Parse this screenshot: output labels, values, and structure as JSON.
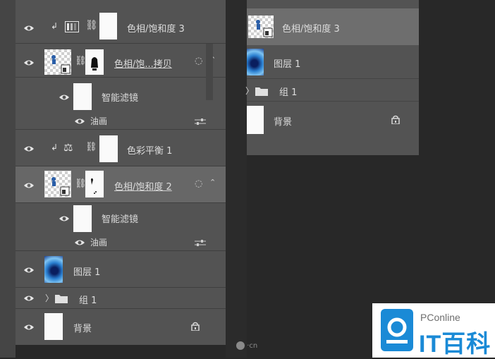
{
  "layers_panel": {
    "rows": [
      {
        "label": "色相/饱和度 3"
      },
      {
        "label": "色相/饱...拷贝"
      },
      {
        "label": "智能滤镜"
      },
      {
        "label": "油画"
      },
      {
        "label": "色彩平衡 1"
      },
      {
        "label": "色相/饱和度 2"
      },
      {
        "label": "智能滤镜"
      },
      {
        "label": "油画"
      },
      {
        "label": "图层 1"
      },
      {
        "label": "组 1"
      },
      {
        "label": "背景"
      }
    ]
  },
  "drag_panel": {
    "rows": [
      {
        "label": "色相/饱和度 3"
      },
      {
        "label": "图层 1"
      },
      {
        "label": "组 1"
      },
      {
        "label": "背景"
      }
    ]
  },
  "watermark": "·cn",
  "logo": {
    "top": "PConline",
    "bottom": "IT百科"
  },
  "colors": {
    "panel": "#535353",
    "selected": "#676767",
    "background": "#282828",
    "brand": "#1a8ad6"
  }
}
